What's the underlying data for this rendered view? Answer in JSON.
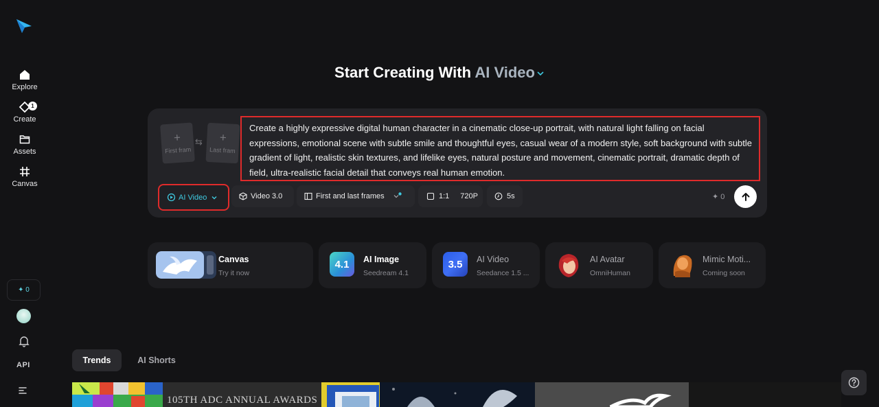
{
  "sidebar": {
    "items": [
      {
        "label": "Explore",
        "icon": "home-icon"
      },
      {
        "label": "Create",
        "icon": "create-icon",
        "badge": "1"
      },
      {
        "label": "Assets",
        "icon": "folder-icon"
      },
      {
        "label": "Canvas",
        "icon": "canvas-icon"
      }
    ],
    "credits": "✦ 0",
    "api_label": "API"
  },
  "heading": {
    "prefix": "Start Creating With",
    "mode": "AI Video"
  },
  "composer": {
    "first_frame": "First fram",
    "last_frame": "Last fram",
    "prompt": "Create a highly expressive digital human character in a cinematic close-up portrait, with natural light falling on facial expressions, emotional scene with subtle smile and thoughtful eyes, casual wear of a modern style, soft background with subtle gradient of light, realistic skin textures, and lifelike eyes, natural posture and movement, cinematic portrait, dramatic depth of field, ultra-realistic facial detail that conveys real human emotion.",
    "mode_label": "AI Video",
    "model_label": "Video 3.0",
    "frames_label": "First and last frames",
    "ratio_label": "1:1",
    "quality_label": "720P",
    "duration_label": "5s",
    "credits": "✦ 0"
  },
  "tools": [
    {
      "title": "Canvas",
      "subtitle": "Try it now"
    },
    {
      "title": "AI Image",
      "subtitle": "Seedream 4.1",
      "thumb_text": "4.1"
    },
    {
      "title": "AI Video",
      "subtitle": "Seedance 1.5 ...",
      "thumb_text": "3.5"
    },
    {
      "title": "AI Avatar",
      "subtitle": "OmniHuman"
    },
    {
      "title": "Mimic Moti...",
      "subtitle": "Coming soon"
    }
  ],
  "tabs": [
    "Trends",
    "AI Shorts"
  ],
  "gallery": {
    "award_text": "105TH ADC ANNUAL AWARDS"
  },
  "colors": {
    "accent": "#3fc9e0",
    "highlight_border": "#e02b2b",
    "background": "#131315",
    "panel": "#232327"
  }
}
